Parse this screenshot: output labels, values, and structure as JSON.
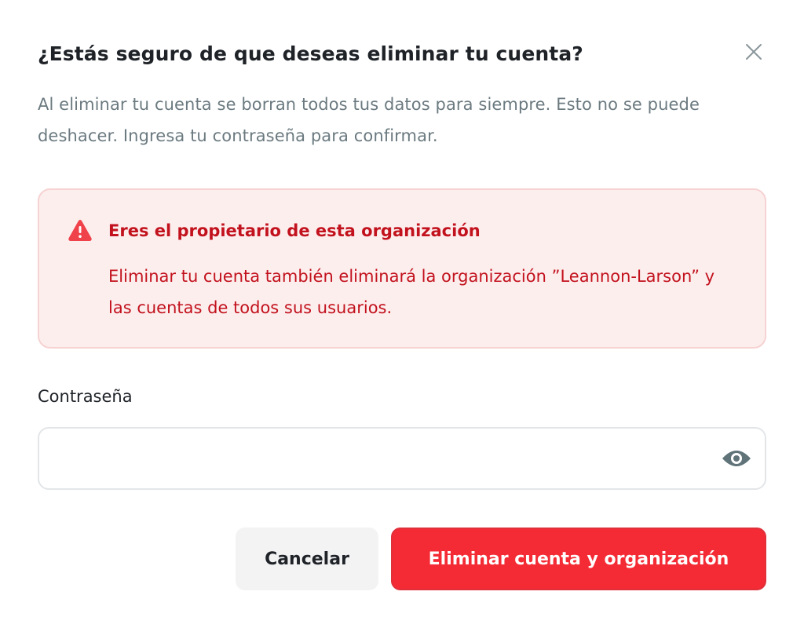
{
  "dialog": {
    "title": "¿Estás seguro de que deseas eliminar tu cuenta?",
    "description": "Al eliminar tu cuenta se borran todos tus datos para siempre. Esto no se puede deshacer. Ingresa tu contraseña para confirmar.",
    "close_icon": "close-icon"
  },
  "alert": {
    "icon": "warning-triangle-icon",
    "title": "Eres el propietario de esta organización",
    "body": "Eliminar tu cuenta también eliminará la organización ”Leannon-Larson” y las cuentas de todos sus usuarios.",
    "colors": {
      "background": "#fdeeee",
      "border": "#f7d2d2",
      "text": "#c2121d",
      "icon": "#f0424a"
    }
  },
  "password": {
    "label": "Contraseña",
    "value": "",
    "placeholder": "",
    "toggle_icon": "eye-icon"
  },
  "actions": {
    "cancel_label": "Cancelar",
    "confirm_label": "Eliminar cuenta y organización",
    "confirm_color": "#f42a34"
  }
}
